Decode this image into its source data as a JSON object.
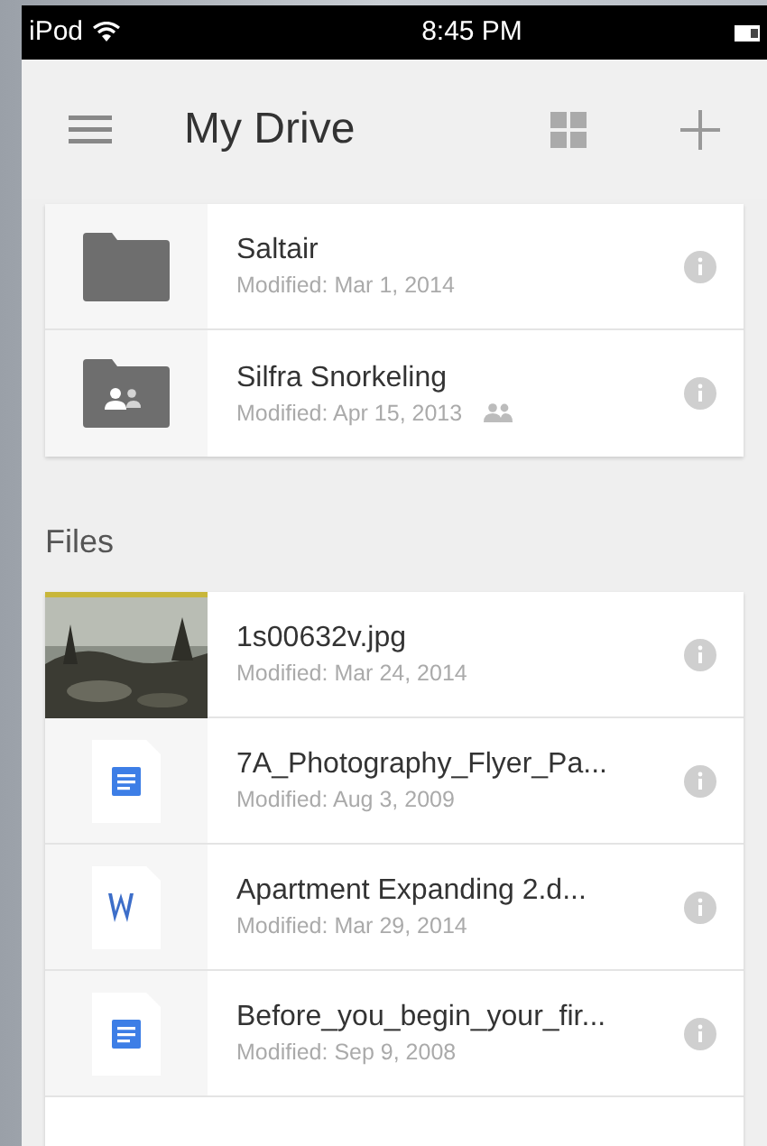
{
  "status_bar": {
    "device": "iPod",
    "time": "8:45 PM"
  },
  "header": {
    "title": "My Drive"
  },
  "folders": [
    {
      "kind": "folder",
      "name": "Saltair",
      "modified": "Modified: Mar 1, 2014",
      "shared": false
    },
    {
      "kind": "shared-folder",
      "name": "Silfra Snorkeling",
      "modified": "Modified: Apr 15, 2013",
      "shared": true
    }
  ],
  "files_heading": "Files",
  "files": [
    {
      "kind": "picture",
      "name": "1s00632v.jpg",
      "modified": "Modified: Mar 24, 2014"
    },
    {
      "kind": "doc",
      "name": "7A_Photography_Flyer_Pa...",
      "modified": "Modified: Aug 3, 2009"
    },
    {
      "kind": "word",
      "name": "Apartment Expanding 2.d...",
      "modified": "Modified: Mar 29, 2014"
    },
    {
      "kind": "doc",
      "name": "Before_you_begin_your_fir...",
      "modified": "Modified: Sep 9, 2008"
    }
  ]
}
